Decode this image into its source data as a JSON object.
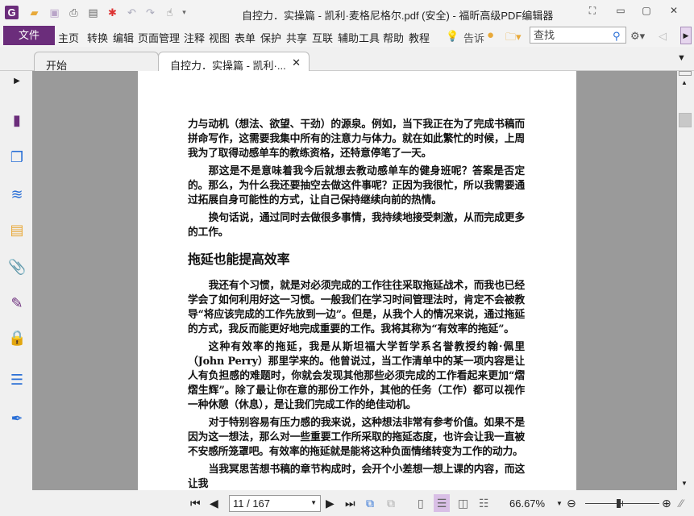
{
  "window": {
    "title": "自控力．实操篇 - 凯利·麦格尼格尔.pdf (安全) - 福昕高级PDF编辑器"
  },
  "menu": {
    "file": "文件",
    "items": [
      "主页",
      "转换",
      "编辑",
      "页面管理",
      "注释",
      "视图",
      "表单",
      "保护",
      "共享",
      "互联",
      "辅助工具",
      "帮助",
      "教程"
    ],
    "tell": "告诉",
    "search_placeholder": "查找"
  },
  "tabs": [
    {
      "label": "开始"
    },
    {
      "label": "自控力．实操篇 - 凯利·..."
    }
  ],
  "document": {
    "paragraphs_top": [
      "力与动机（想法、欲望、干劲）的源泉。例如，当下我正在为了完成书稿而拼命写作，这需要我集中所有的注意力与体力。就在如此繁忙的时候，上周我为了取得动感单车的教练资格，还特意停笔了一天。",
      "那这是不是意味着我今后就想去教动感单车的健身班呢？答案是否定的。那么，为什么我还要抽空去做这件事呢？正因为我很忙，所以我需要通过拓展自身可能性的方式，让自己保持继续向前的热情。",
      "换句话说，通过同时去做很多事情，我持续地接受刺激，从而完成更多的工作。"
    ],
    "heading": "拖延也能提高效率",
    "paragraphs_bottom": [
      "我还有个习惯，就是对必须完成的工作往往采取拖延战术，而我也已经学会了如何利用好这一习惯。一般我们在学习时间管理法时，肯定不会被教导“将应该完成的工作先放到一边”。但是，从我个人的情况来说，通过拖延的方式，我反而能更好地完成重要的工作。我将其称为“有效率的拖延”。",
      "这种有效率的拖延，我是从斯坦福大学哲学系名誉教授约翰·佩里（John Perry）那里学来的。他曾说过，当工作清单中的某一项内容是让人有负担感的难题时，你就会发现其他那些必须完成的工作看起来更加“熠熠生辉”。除了最让你在意的那份工作外，其他的任务（工作）都可以视作一种休憩（休息），是让我们完成工作的绝佳动机。",
      "对于特别容易有压力感的我来说，这种想法非常有参考价值。如果不是因为这一想法，那么对一些重要工作所采取的拖延态度，也许会让我一直被不安感所笼罩吧。有效率的拖延就是能将这种负面情绪转变为工作的动力。",
      "当我冥思苦想书稿的章节构成时，会开个小差想一想上课的内容，而这让我"
    ]
  },
  "status": {
    "page": "11 / 167",
    "zoom": "66.67%",
    "zoom_fraction": 0.45
  },
  "colors": {
    "accent": "#6b2d7b",
    "doc_bg": "#9a9a9a"
  }
}
